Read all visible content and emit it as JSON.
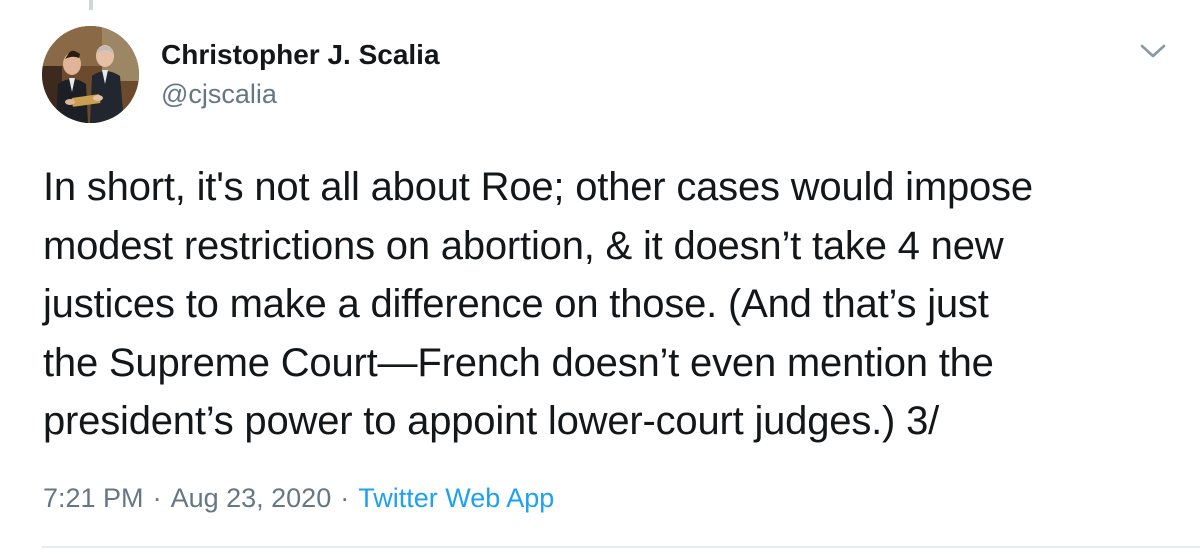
{
  "tweet": {
    "author": {
      "display_name": "Christopher J. Scalia",
      "handle": "@cjscalia"
    },
    "text_lines": [
      "In short, it's not all about Roe; other cases would impose",
      "modest restrictions on abortion, & it doesn’t take 4 new",
      "justices to make a difference on those. (And that’s just",
      "the Supreme Court—French doesn’t even mention the",
      "president’s power to appoint lower-court judges.) 3/"
    ],
    "meta": {
      "time": "7:21 PM",
      "separator": "·",
      "date": "Aug 23, 2020",
      "source": "Twitter Web App"
    }
  },
  "icons": {
    "menu": "chevron-down-icon",
    "avatar": "profile-photo"
  },
  "colors": {
    "text": "#14171a",
    "secondary": "#657786",
    "link": "#1da1f2",
    "divider": "#e6ecf0",
    "thread_line": "#ccd6dd"
  }
}
